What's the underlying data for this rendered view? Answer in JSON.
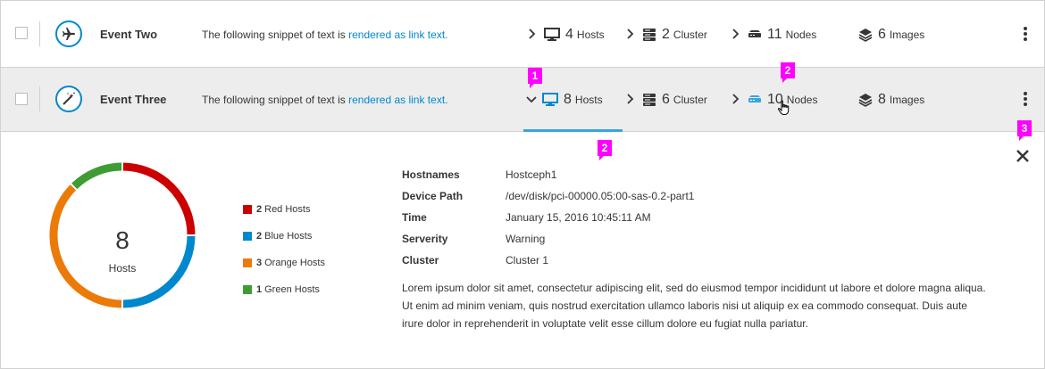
{
  "rows": [
    {
      "title": "Event Two",
      "desc_prefix": "The following snippet of text is ",
      "desc_link": "rendered as link text.",
      "icon": "airplane-icon",
      "items": [
        {
          "num": "4",
          "label": "Hosts",
          "icon": "monitor-icon"
        },
        {
          "num": "2",
          "label": "Cluster",
          "icon": "server-stack-icon"
        },
        {
          "num": "11",
          "label": "Nodes",
          "icon": "node-icon"
        },
        {
          "num": "6",
          "label": "Images",
          "icon": "layers-icon"
        }
      ]
    },
    {
      "title": "Event Three",
      "desc_prefix": "The following snippet of text is ",
      "desc_link": "rendered as link text.",
      "icon": "magic-wand-icon",
      "items": [
        {
          "num": "8",
          "label": "Hosts",
          "icon": "monitor-icon"
        },
        {
          "num": "6",
          "label": "Cluster",
          "icon": "server-stack-icon"
        },
        {
          "num": "10",
          "label": "Nodes",
          "icon": "node-icon"
        },
        {
          "num": "8",
          "label": "Images",
          "icon": "layers-icon"
        }
      ]
    }
  ],
  "markers": [
    "1",
    "2",
    "2",
    "3"
  ],
  "donut": {
    "total": "8",
    "label": "Hosts",
    "segments": [
      {
        "count": "2",
        "name": "Red Hosts",
        "value": 2,
        "color": "#cc0000"
      },
      {
        "count": "2",
        "name": "Blue Hosts",
        "value": 2,
        "color": "#0088ce"
      },
      {
        "count": "3",
        "name": "Orange Hosts",
        "value": 3,
        "color": "#ec7a08"
      },
      {
        "count": "1",
        "name": "Green Hosts",
        "value": 1,
        "color": "#3f9c35"
      }
    ]
  },
  "details": [
    {
      "key": "Hostnames",
      "value": "Hostceph1"
    },
    {
      "key": "Device Path",
      "value": "/dev/disk/pci-00000.05:00-sas-0.2-part1"
    },
    {
      "key": "Time",
      "value": "January 15, 2016 10:45:11 AM"
    },
    {
      "key": "Serverity",
      "value": "Warning"
    },
    {
      "key": "Cluster",
      "value": "Cluster 1"
    }
  ],
  "description": "Lorem ipsum dolor sit amet, consectetur adipiscing elit, sed do eiusmod tempor incididunt ut labore et dolore magna aliqua. Ut enim ad minim veniam, quis nostrud exercitation ullamco laboris nisi ut aliquip ex ea commodo consequat. Duis aute irure dolor in reprehenderit in voluptate velit esse cillum dolore eu fugiat nulla pariatur.",
  "colors": {
    "accent": "#0088ce",
    "marker": "#ff00ff",
    "active_underline": "#39a5dc"
  }
}
